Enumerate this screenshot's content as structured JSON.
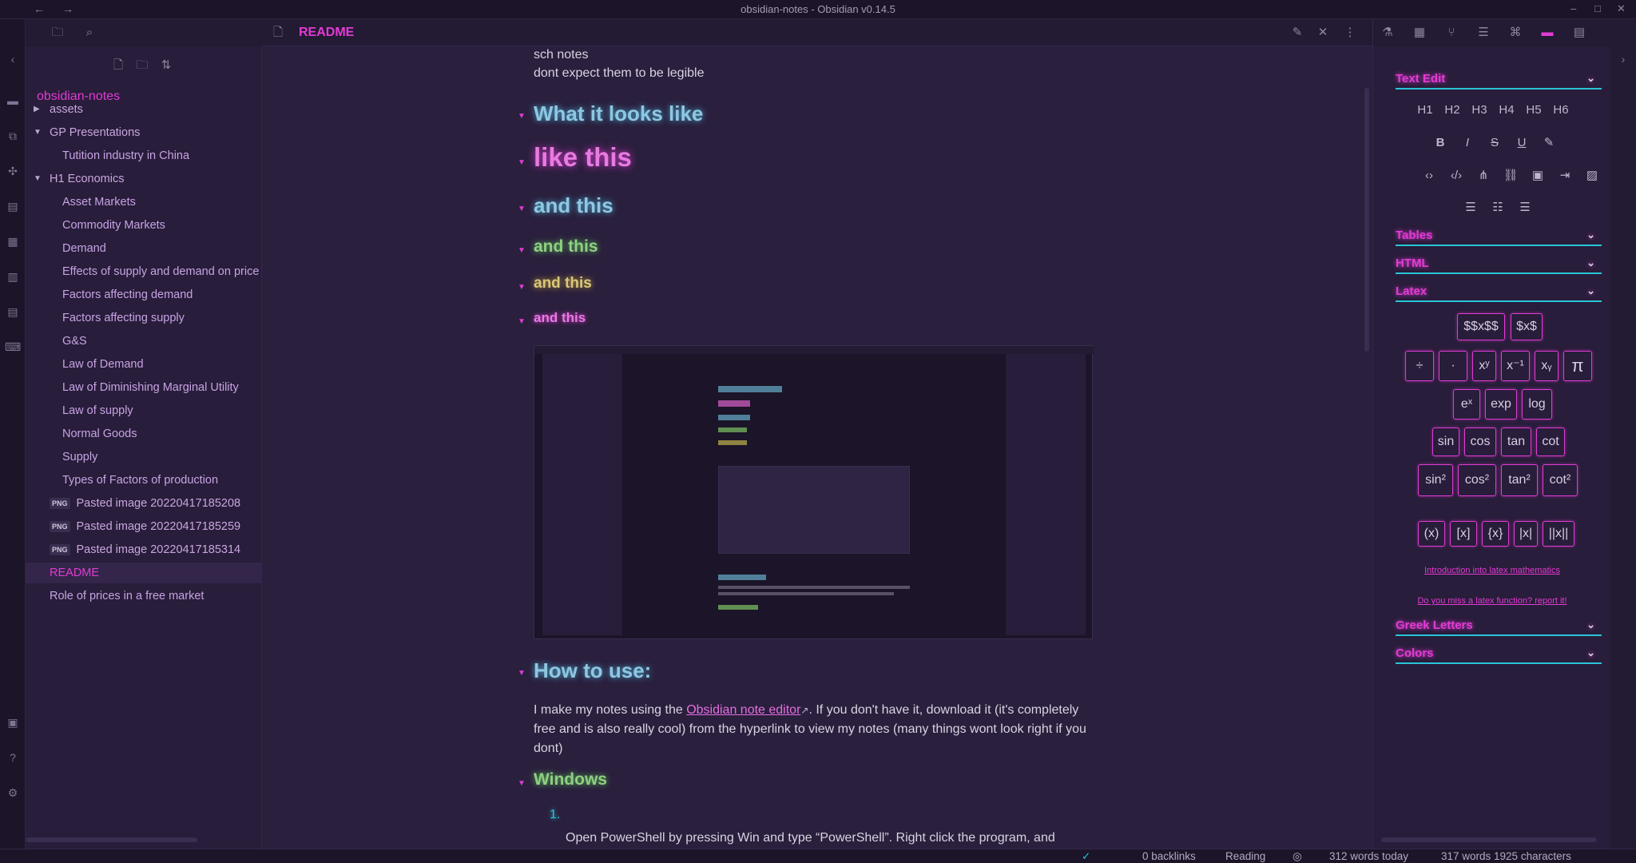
{
  "window": {
    "title": "obsidian-notes - Obsidian v0.14.5",
    "back": "←",
    "forward": "→",
    "minimize": "–",
    "maximize": "□",
    "close": "✕"
  },
  "left_panel": {
    "vault_name": "obsidian-notes",
    "items": [
      {
        "label": "assets",
        "type": "folder",
        "expanded": false
      },
      {
        "label": "GP Presentations",
        "type": "folder",
        "expanded": true
      },
      {
        "label": "Tutition industry in China",
        "type": "file"
      },
      {
        "label": "H1 Economics",
        "type": "folder",
        "expanded": true
      },
      {
        "label": "Asset Markets",
        "type": "file"
      },
      {
        "label": "Commodity Markets",
        "type": "file"
      },
      {
        "label": "Demand",
        "type": "file"
      },
      {
        "label": "Effects of supply and demand on price",
        "type": "file"
      },
      {
        "label": "Factors affecting demand",
        "type": "file"
      },
      {
        "label": "Factors affecting supply",
        "type": "file"
      },
      {
        "label": "G&S",
        "type": "file"
      },
      {
        "label": "Law of Demand",
        "type": "file"
      },
      {
        "label": "Law of Diminishing Marginal Utility",
        "type": "file"
      },
      {
        "label": "Law of supply",
        "type": "file"
      },
      {
        "label": "Normal Goods",
        "type": "file"
      },
      {
        "label": "Supply",
        "type": "file"
      },
      {
        "label": "Types of Factors of production",
        "type": "file"
      },
      {
        "label": "Pasted image 20220417185208",
        "type": "png"
      },
      {
        "label": "Pasted image 20220417185259",
        "type": "png"
      },
      {
        "label": "Pasted image 20220417185314",
        "type": "png"
      },
      {
        "label": "README",
        "type": "file",
        "active": true
      },
      {
        "label": "Role of prices in a free market",
        "type": "file"
      }
    ],
    "png_badge": "PNG"
  },
  "tab": {
    "title": "README"
  },
  "note": {
    "intro1": "sch notes",
    "intro2": "dont expect them to be legible",
    "h1": "What it looks like",
    "h2": "like this",
    "h3": "and this",
    "h4": "and this",
    "h5": "and this",
    "h6": "and this",
    "howto": "How to use:",
    "para_a": "I make my notes using the ",
    "para_link": "Obsidian note editor",
    "para_b": ". If you don't have it, download it (it's completely free and is also really cool) from the hyperlink to view my notes (many things wont look right if you dont)",
    "windows": "Windows",
    "list_num": "1.",
    "step1": "Open PowerShell by pressing Win and type “PowerShell”. Right click the program, and"
  },
  "right_panel": {
    "text_edit": "Text Edit",
    "headings": [
      "H1",
      "H2",
      "H3",
      "H4",
      "H5",
      "H6"
    ],
    "tables": "Tables",
    "html": "HTML",
    "latex": "Latex",
    "latex_buttons": {
      "block": "$$x$$",
      "inline": "$x$",
      "div": "÷",
      "dot": "·",
      "pow": "xʸ",
      "inv": "x⁻¹",
      "sub": "xᵧ",
      "pi": "π",
      "ex": "eˣ",
      "exp": "exp",
      "log": "log",
      "sin": "sin",
      "cos": "cos",
      "tan": "tan",
      "cot": "cot",
      "sin2": "sin²",
      "cos2": "cos²",
      "tan2": "tan²",
      "cot2": "cot²",
      "paren": "(x)",
      "brack": "[x]",
      "brace": "{x}",
      "abs": "|x|",
      "norm": "||x||"
    },
    "intro_link": "Introduction into latex mathematics",
    "miss_link": "Do you miss a latex function? report it!",
    "greek": "Greek Letters",
    "colors": "Colors"
  },
  "status": {
    "check": "✓",
    "backlinks": "0 backlinks",
    "mode": "Reading",
    "words_today": "312 words today",
    "counts": "317 words 1925 characters"
  },
  "colors": {
    "accent": "#e23bd4",
    "cyan": "#29c4d9",
    "green": "#8fcf82",
    "yellow": "#d9c67a"
  }
}
